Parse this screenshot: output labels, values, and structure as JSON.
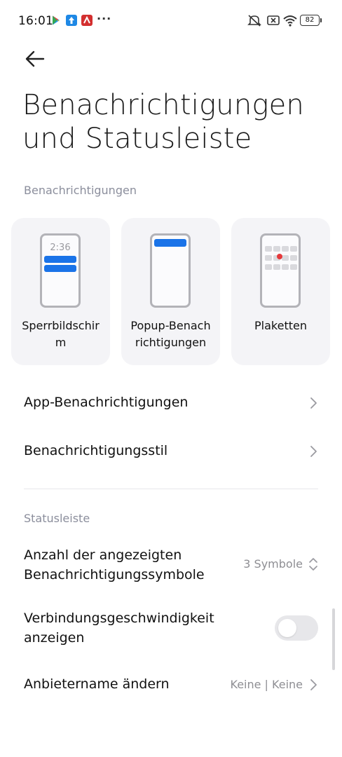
{
  "status_bar": {
    "time": "16:01",
    "battery": "82",
    "more": "···"
  },
  "header": {
    "title_line1": "Benachrichtigungen",
    "title_line2": "und Statusleiste"
  },
  "notifications_section": {
    "label": "Benachrichtigungen",
    "cards": [
      {
        "label": "Sperrbildschirm",
        "line1": "Sperrbildschir",
        "line2": "m",
        "phone_time": "2:36",
        "icon": "lockscreen-preview-icon"
      },
      {
        "label": "Popup-Benachrichtigungen",
        "line1": "Popup-Benach",
        "line2": "richtigungen",
        "icon": "popup-preview-icon"
      },
      {
        "label": "Plaketten",
        "line1": "Plaketten",
        "line2": "",
        "icon": "badge-preview-icon"
      }
    ],
    "items": [
      {
        "label": "App-Benachrichtigungen"
      },
      {
        "label": "Benachrichtigungsstil"
      }
    ]
  },
  "statusbar_section": {
    "label": "Statusleiste",
    "icon_count": {
      "label_line1": "Anzahl der angezeigten",
      "label_line2": "Benachrichtigungssymbole",
      "value": "3 Symbole"
    },
    "speed": {
      "label_line1": "Verbindungsgeschwindigkeit",
      "label_line2": "anzeigen",
      "enabled": false
    },
    "carrier": {
      "label": "Anbietername ändern",
      "value": "Keine | Keine"
    }
  },
  "colors": {
    "accent": "#1a73e8",
    "badge": "#e5393c",
    "card_bg": "#f4f4f7",
    "secondary_text": "#8b8e9c"
  }
}
